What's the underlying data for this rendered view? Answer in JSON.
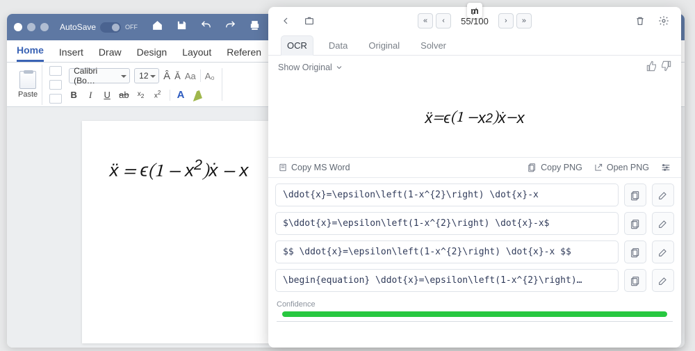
{
  "word": {
    "autosave_label": "AutoSave",
    "autosave_state": "OFF",
    "tabs": [
      "Home",
      "Insert",
      "Draw",
      "Design",
      "Layout",
      "Referen"
    ],
    "active_tab": 0,
    "paste_label": "Paste",
    "font_name": "Calibri (Bo…",
    "font_size": "12",
    "equation_html": "<i>ẍ</i> = <i>ϵ</i>(1 − <i>x</i><sup>2</sup>)<i>ẋ</i> − <i>x</i>"
  },
  "panel": {
    "thumb_glyph": "₥",
    "pager": {
      "current": "55",
      "total": "100",
      "joined": "55/100"
    },
    "tabs": [
      "OCR",
      "Data",
      "Original",
      "Solver"
    ],
    "active_tab": 0,
    "show_original_label": "Show Original",
    "rendered_equation_html": "<i>ẍ</i> = <i>ϵ</i>(1 − <i>x</i><sup>2</sup>)<i>ẋ</i> − <i>x</i>",
    "actions": {
      "copy_word": "Copy MS Word",
      "copy_png": "Copy PNG",
      "open_png": "Open PNG"
    },
    "latex_rows": [
      "\\ddot{x}=\\epsilon\\left(1-x^{2}\\right) \\dot{x}-x",
      "$\\ddot{x}=\\epsilon\\left(1-x^{2}\\right) \\dot{x}-x$",
      "$$ \\ddot{x}=\\epsilon\\left(1-x^{2}\\right) \\dot{x}-x $$",
      "\\begin{equation} \\ddot{x}=\\epsilon\\left(1-x^{2}\\right)…"
    ],
    "confidence_label": "Confidence",
    "confidence_pct": 100
  }
}
